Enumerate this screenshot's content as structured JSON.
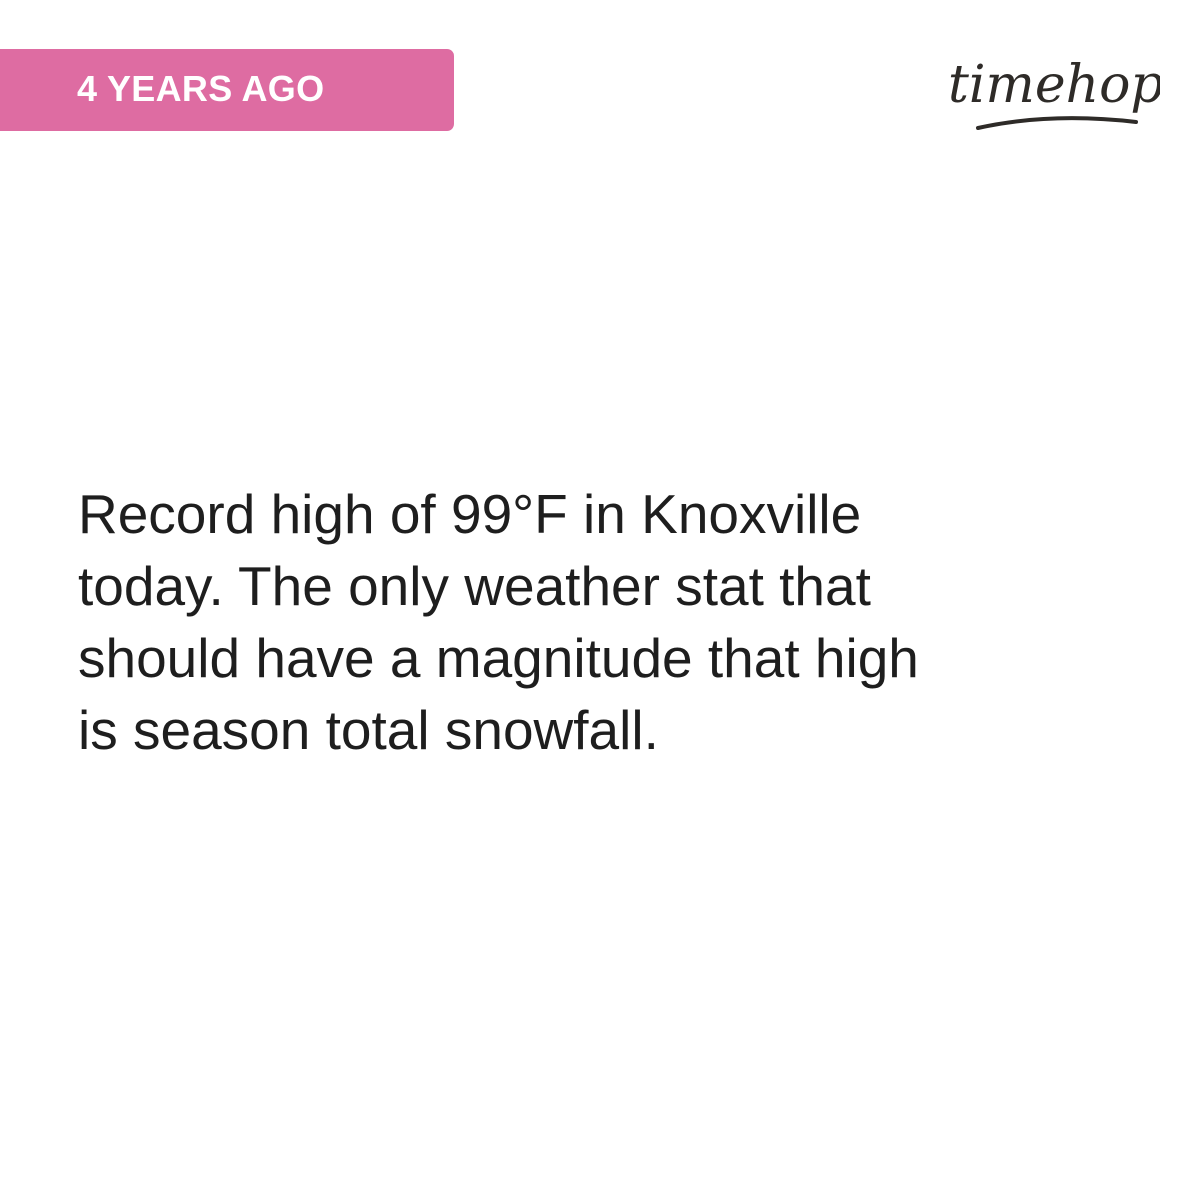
{
  "theme": {
    "accent": "#de6ca2",
    "text": "#1e1e1e",
    "logo_color": "#2e2b28"
  },
  "header": {
    "badge_label": "4 YEARS AGO",
    "logo_text": "timehop"
  },
  "post": {
    "text": "Record high of 99°F in Knoxville\ntoday. The only weather stat that\nshould have a magnitude that high\nis season total snowfall."
  }
}
